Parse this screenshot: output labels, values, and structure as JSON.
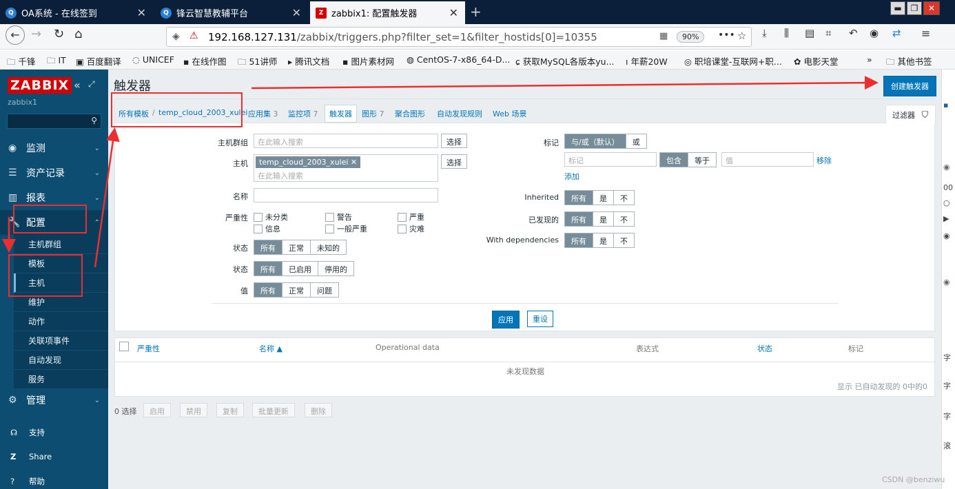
{
  "browser": {
    "tabs": [
      {
        "title": "OA系统 - 在线签到",
        "icon": "q-icon"
      },
      {
        "title": "锋云智慧教辅平台",
        "icon": "q-icon"
      },
      {
        "title": "zabbix1: 配置触发器",
        "icon": "z-icon"
      }
    ],
    "url_host": "192.168.127.131",
    "url_path": "/zabbix/triggers.php?filter_set=1&filter_hostids[0]=10355",
    "zoom": "90%",
    "bookmarks": [
      "千锋",
      "IT",
      "百度翻译",
      "UNICEF",
      "在线作图",
      "51讲师",
      "腾讯文档",
      "图片素材网",
      "CentOS-7-x86_64-D...",
      "获取MySQL各版本yu...",
      "年薪20W",
      "职培课堂-互联网+职...",
      "电影天堂",
      "其他书签"
    ]
  },
  "sidebar": {
    "logo": "ZABBIX",
    "instance": "zabbix1",
    "menu": {
      "monitoring": "监测",
      "inventory": "资产记录",
      "reports": "报表",
      "config": "配置",
      "admin": "管理"
    },
    "config_sub": [
      "主机群组",
      "模板",
      "主机",
      "维护",
      "动作",
      "关联项事件",
      "自动发现",
      "服务"
    ],
    "lower": [
      "支持",
      "Share",
      "帮助"
    ]
  },
  "page": {
    "title": "触发器",
    "create_button": "创建触发器",
    "breadcrumb": {
      "all_templates": "所有模板",
      "sep": "/",
      "template": "temp_cloud_2003_xulei",
      "apps": "应用集",
      "apps_count": "3",
      "items": "监控项",
      "items_count": "7",
      "triggers": "触发器",
      "graphs": "图形",
      "graphs_count": "7",
      "screens": "聚合图形",
      "discovery": "自动发现规则",
      "web": "Web 场景"
    },
    "filter_tab": "过滤器",
    "filter": {
      "host_group": "主机群组",
      "host": "主机",
      "name": "名称",
      "severity": "严重性",
      "state": "状态",
      "status": "状态",
      "value": "值",
      "search_placeholder": "在此输入搜索",
      "select": "选择",
      "host_tag": "temp_cloud_2003_xulei",
      "severities": [
        "未分类",
        "警告",
        "严重",
        "信息",
        "一般严重",
        "灾难"
      ],
      "state_opts": [
        "所有",
        "正常",
        "未知的"
      ],
      "status_opts": [
        "所有",
        "已启用",
        "停用的"
      ],
      "value_opts": [
        "所有",
        "正常",
        "问题"
      ],
      "tags": "标记",
      "tag_ops": [
        "与/或（默认）",
        "或"
      ],
      "tag_placeholder": "标记",
      "tag_match": [
        "包含",
        "等于"
      ],
      "value_placeholder": "值",
      "remove": "移除",
      "add": "添加",
      "inherited": "Inherited",
      "discovered": "已发现的",
      "with_dep": "With dependencies",
      "yes_no": [
        "所有",
        "是",
        "不"
      ],
      "apply": "应用",
      "reset": "重设"
    },
    "table": {
      "cols": {
        "severity": "严重性",
        "name": "名称 ▲",
        "opdata": "Operational data",
        "expression": "表达式",
        "status": "状态",
        "tags": "标记"
      },
      "nodata": "未发现数据",
      "footer": "显示 已自动发现的 0中的0"
    },
    "bottom": {
      "selected": "0 选择",
      "actions": [
        "启用",
        "禁用",
        "复制",
        "批量更新",
        "删除"
      ]
    }
  },
  "right_panel": [
    "00",
    "字",
    "字",
    "字",
    "滚"
  ],
  "watermark": "CSDN @benziwu",
  "colors": {
    "accent": "#0275b8",
    "sidebar": "#0d4d72",
    "annotation": "#ee2e2e"
  }
}
